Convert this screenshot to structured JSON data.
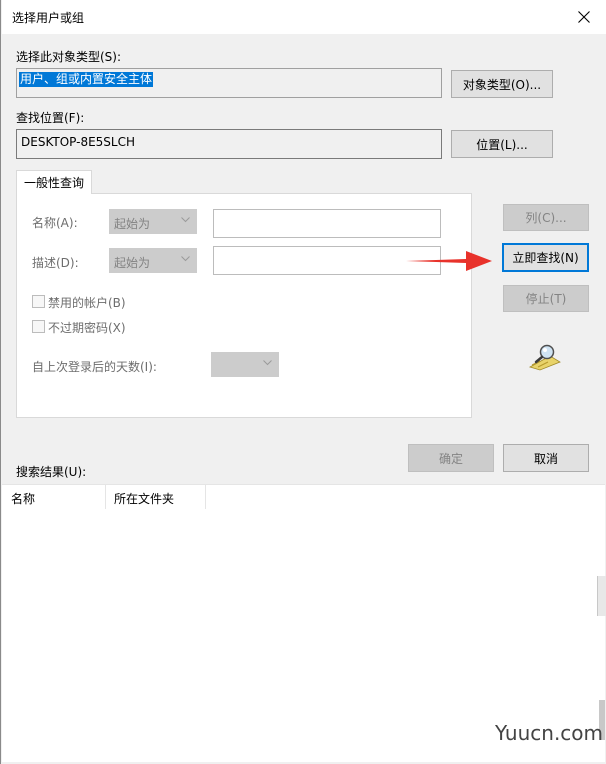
{
  "window": {
    "title": "选择用户或组"
  },
  "object_type": {
    "label": "选择此对象类型(S):",
    "value": "用户、组或内置安全主体",
    "button": "对象类型(O)..."
  },
  "location": {
    "label": "查找位置(F):",
    "value": "DESKTOP-8E5SLCH",
    "button": "位置(L)..."
  },
  "tabs": {
    "general": "一般性查询"
  },
  "query": {
    "name_label": "名称(A):",
    "name_mode": "起始为",
    "desc_label": "描述(D):",
    "desc_mode": "起始为",
    "disabled_accounts": "禁用的帐户(B)",
    "non_expiring_pwd": "不过期密码(X)",
    "days_since_login": "自上次登录后的天数(I):"
  },
  "buttons": {
    "columns": "列(C)...",
    "find_now": "立即查找(N)",
    "stop": "停止(T)",
    "ok": "确定",
    "cancel": "取消"
  },
  "results": {
    "label": "搜索结果(U):",
    "columns": [
      "名称",
      "所在文件夹"
    ]
  },
  "watermark": "Yuucn.com",
  "colors": {
    "selection": "#0078d7",
    "arrow": "#e8322b",
    "focus_border": "#0078d7"
  }
}
